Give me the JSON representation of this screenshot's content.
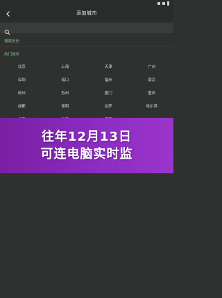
{
  "title": "添加城市",
  "search": {
    "placeholder": ""
  },
  "sections": {
    "history": "搜索历史",
    "hot": "热门城市"
  },
  "hot_cities": [
    [
      "北京",
      "上海",
      "天津",
      "广州"
    ],
    [
      "深圳",
      "海口",
      "福州",
      "南京"
    ],
    [
      "杭州",
      "苏州",
      "厦门",
      "重庆"
    ],
    [
      "成都",
      "昆明",
      "拉萨",
      "哈尔滨"
    ],
    [
      "长春",
      "沈阳",
      "济南",
      ""
    ]
  ],
  "overlay": {
    "line1": "往年12月13日",
    "line2": "可连电脑实时监"
  },
  "colors": {
    "background": "#2f3131",
    "accent_green": "#7ec27e",
    "overlay_purple": "#8a2bbf"
  }
}
